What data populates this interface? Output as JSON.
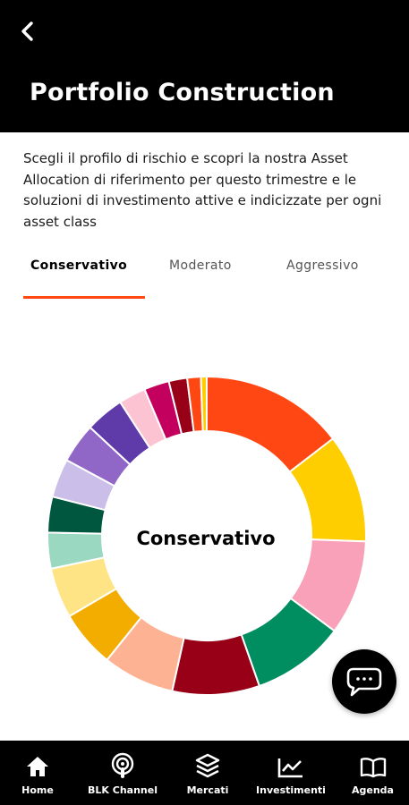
{
  "header": {
    "title": "Portfolio Construction",
    "back_icon": "chevron-left-icon"
  },
  "intro": {
    "text": "Scegli il profilo di rischio e scopri la nostra Asset Allocation di riferimento per questo trimestre e le soluzioni di investimento attive e indicizzate per ogni asset class"
  },
  "tabs": [
    {
      "label": "Conservativo",
      "active": true
    },
    {
      "label": "Moderato",
      "active": false
    },
    {
      "label": "Aggressivo",
      "active": false
    }
  ],
  "accent_color": "#ff4713",
  "chart_data": {
    "type": "pie",
    "center_label": "Conservativo",
    "slices": [
      {
        "value": 14.8,
        "color": "#ff4713"
      },
      {
        "value": 11.2,
        "color": "#ffce00"
      },
      {
        "value": 9.8,
        "color": "#f8a1b9"
      },
      {
        "value": 9.6,
        "color": "#008d5f"
      },
      {
        "value": 9.0,
        "color": "#970017"
      },
      {
        "value": 7.4,
        "color": "#fdb393"
      },
      {
        "value": 5.9,
        "color": "#f2ad00"
      },
      {
        "value": 5.2,
        "color": "#ffe486"
      },
      {
        "value": 3.7,
        "color": "#9ad8c2"
      },
      {
        "value": 3.7,
        "color": "#00573f"
      },
      {
        "value": 4.0,
        "color": "#cbbfe9"
      },
      {
        "value": 4.1,
        "color": "#9067c7"
      },
      {
        "value": 4.0,
        "color": "#5f3aa9"
      },
      {
        "value": 2.8,
        "color": "#fcc3d2"
      },
      {
        "value": 2.6,
        "color": "#c3005e"
      },
      {
        "value": 1.9,
        "color": "#970017"
      },
      {
        "value": 1.4,
        "color": "#ff4713"
      },
      {
        "value": 0.6,
        "color": "#ffce00"
      }
    ]
  },
  "chat_button": {
    "icon": "chat-bubble-icon"
  },
  "bottom_nav": [
    {
      "label": "Home",
      "icon": "home-icon"
    },
    {
      "label": "BLK Channel",
      "icon": "podcast-icon"
    },
    {
      "label": "Mercati",
      "icon": "layers-icon"
    },
    {
      "label": "Investimenti",
      "icon": "trending-chart-icon"
    },
    {
      "label": "Agenda",
      "icon": "book-icon"
    }
  ]
}
